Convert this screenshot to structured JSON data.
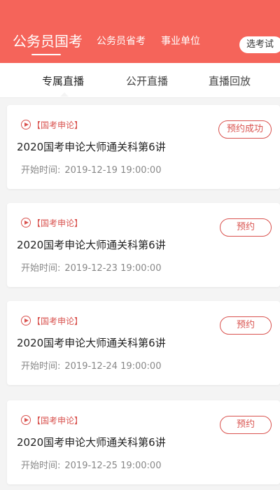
{
  "header": {
    "tabs": [
      {
        "label": "公务员国考"
      },
      {
        "label": "公务员省考"
      },
      {
        "label": "事业单位"
      }
    ],
    "exam_select": "选考试"
  },
  "subtabs": [
    {
      "label": "专属直播"
    },
    {
      "label": "公开直播"
    },
    {
      "label": "直播回放"
    }
  ],
  "cards": [
    {
      "tag": "【国考申论】",
      "title": "2020国考申论大师通关科第6讲",
      "time_label": "开始时间:",
      "time": "2019-12-19 19:00:00",
      "button": "预约成功"
    },
    {
      "tag": "【国考申论】",
      "title": "2020国考申论大师通关科第6讲",
      "time_label": "开始时间:",
      "time": "2019-12-23 19:00:00",
      "button": "预约"
    },
    {
      "tag": "【国考申论】",
      "title": "2020国考申论大师通关科第6讲",
      "time_label": "开始时间:",
      "time": "2019-12-24 19:00:00",
      "button": "预约"
    },
    {
      "tag": "【国考申论】",
      "title": "2020国考申论大师通关科第6讲",
      "time_label": "开始时间:",
      "time": "2019-12-25 19:00:00",
      "button": "预约"
    }
  ],
  "colors": {
    "header_bg": "#f5645a",
    "accent": "#d9534f"
  }
}
